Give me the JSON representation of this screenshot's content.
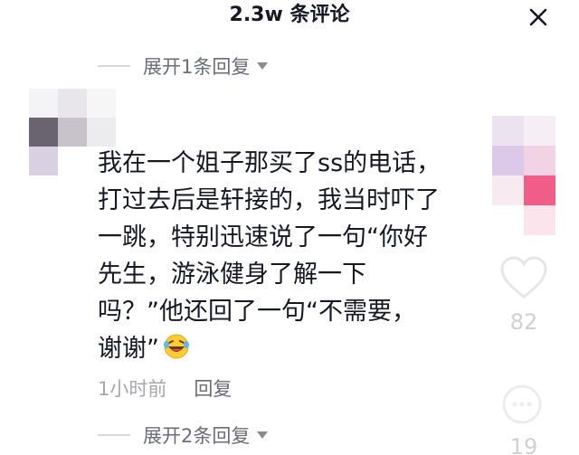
{
  "header": {
    "title": "2.3w 条评论",
    "close_icon": "close-icon"
  },
  "expand_top": {
    "label": "展开1条回复",
    "icon": "caret-down-icon"
  },
  "comment": {
    "lines": [
      "我在一个姐子那买了ss的电话，",
      "打过去后是轩接的，我当时吓了",
      "一跳，特别迅速说了一句“你好",
      "先生，游泳健身了解一下",
      "吗？”他还回了一句“不需要，",
      "谢谢”"
    ],
    "emoji": "laughing-crying-emoji",
    "time": "1小时前",
    "reply_label": "回复",
    "like_count": "82",
    "dislike_count": "19"
  },
  "expand_bottom": {
    "label": "展开2条回复",
    "icon": "caret-down-icon"
  },
  "colors": {
    "text": "#161823",
    "secondary": "#6b6d74",
    "muted": "#a7a8ad",
    "count": "#cfd0d3"
  }
}
